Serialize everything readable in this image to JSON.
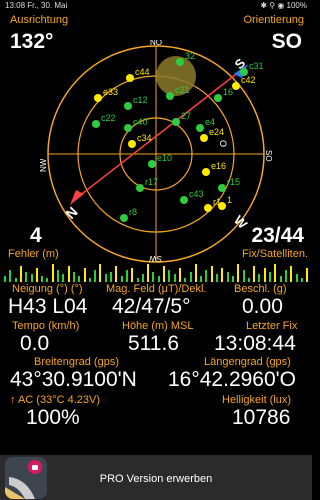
{
  "status_bar": {
    "time_date": "13:08 Fr., 30. Mai",
    "battery": "100%"
  },
  "header": {
    "bearing_label": "Ausrichtung",
    "bearing_value": "132°",
    "orientation_label": "Orientierung",
    "orientation_value": "SO"
  },
  "compass": {
    "cardinals": {
      "N": "N",
      "E": "O",
      "S": "S",
      "W": "W",
      "NE": "NO",
      "SE": "SO",
      "SW": "SW",
      "NW": "NW"
    },
    "satellites": [
      {
        "label": "32",
        "color": "green"
      },
      {
        "label": "c44",
        "color": "yellow"
      },
      {
        "label": "c42",
        "color": "yellow"
      },
      {
        "label": "c31",
        "color": "green"
      },
      {
        "label": "e33",
        "color": "yellow"
      },
      {
        "label": "c21",
        "color": "green"
      },
      {
        "label": "16",
        "color": "green"
      },
      {
        "label": "c12",
        "color": "green"
      },
      {
        "label": "c22",
        "color": "green"
      },
      {
        "label": "c40",
        "color": "green"
      },
      {
        "label": "27",
        "color": "green"
      },
      {
        "label": "e24",
        "color": "yellow"
      },
      {
        "label": "e4",
        "color": "green"
      },
      {
        "label": "c34",
        "color": "yellow"
      },
      {
        "label": "e10",
        "color": "green"
      },
      {
        "label": "e16",
        "color": "yellow"
      },
      {
        "label": "r17",
        "color": "green"
      },
      {
        "label": "r15",
        "color": "green"
      },
      {
        "label": "r1",
        "color": "yellow"
      },
      {
        "label": "c43",
        "color": "green"
      },
      {
        "label": "r8",
        "color": "green"
      },
      {
        "label": "1",
        "color": "yellow"
      }
    ]
  },
  "accuracy": {
    "value": "4",
    "label": "Fehler (m)"
  },
  "fix": {
    "value": "23/44",
    "label": "Fix/Satelliten."
  },
  "signal_bars": [
    3,
    6,
    2,
    8,
    5,
    4,
    7,
    3,
    2,
    9,
    6,
    4,
    8,
    5,
    3,
    7,
    2,
    6,
    9,
    4,
    5,
    8,
    3,
    6,
    7,
    2,
    4,
    9,
    5,
    3,
    8,
    6,
    4,
    7,
    2,
    5,
    9,
    3,
    6,
    8,
    4,
    7,
    5,
    3,
    9,
    6,
    2,
    8,
    4,
    7,
    5,
    9,
    3,
    6,
    8,
    4,
    2,
    7
  ],
  "row1": {
    "tilt_label": "Neigung (°) (°)",
    "tilt_value": "H43 L04",
    "mag_label": "Mag. Feld (μT)/Dekl.",
    "mag_value": "42/47/5°",
    "accel_label": "Beschl. (g)",
    "accel_value": "0.00"
  },
  "row2": {
    "speed_label": "Tempo (km/h)",
    "speed_value": "0.0",
    "alt_label": "Höhe (m) MSL",
    "alt_value": "511.6",
    "fix_label": "Letzter Fix",
    "fix_value": "13:08:44"
  },
  "row3": {
    "lat_label": "Breitengrad (gps)",
    "lat_value": "43°30.9100'N",
    "lon_label": "Längengrad (gps)",
    "lon_value": "16°42.2960'O"
  },
  "row4": {
    "battery_label": "↑ AC (33°C 4.23V)",
    "battery_value": "100%",
    "light_label": "Helligkeit (lux)",
    "light_value": "10786"
  },
  "promo": {
    "label": "PRO Version erwerben"
  },
  "colors": {
    "accent": "#f5a623",
    "green": "#2ecc40",
    "yellow": "#ffea00"
  }
}
